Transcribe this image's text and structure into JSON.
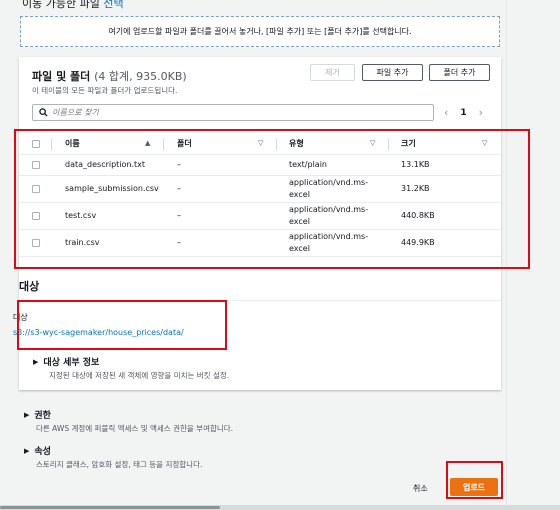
{
  "top_partial": {
    "prefix": "이동 가능한 파일 ",
    "link": "선택"
  },
  "dropzone": {
    "text": "여기에 업로드할 파일과 폴더를 끌어서 놓거나, [파일 추가] 또는 [폴더 추가]를 선택합니다."
  },
  "files_panel": {
    "title": "파일 및 폴더",
    "count": "(4 합계, 935.0KB)",
    "description": "이 테이블의 모든 파일과 폴더가 업로드됩니다.",
    "buttons": {
      "remove": "제거",
      "add_files": "파일 추가",
      "add_folder": "폴더 추가"
    },
    "search_placeholder": "이름으로 찾기",
    "page_number": "1",
    "columns": {
      "name": "이름",
      "folder": "폴더",
      "type": "유형",
      "size": "크기"
    },
    "rows": [
      {
        "name": "data_description.txt",
        "folder": "–",
        "type_line1": "text/plain",
        "type_line2": "",
        "size": "13.1KB"
      },
      {
        "name": "sample_submission.csv",
        "folder": "–",
        "type_line1": "application/vnd.ms-",
        "type_line2": "excel",
        "size": "31.2KB"
      },
      {
        "name": "test.csv",
        "folder": "–",
        "type_line1": "application/vnd.ms-",
        "type_line2": "excel",
        "size": "440.8KB"
      },
      {
        "name": "train.csv",
        "folder": "–",
        "type_line1": "application/vnd.ms-",
        "type_line2": "excel",
        "size": "449.9KB"
      }
    ]
  },
  "destination": {
    "title": "대상",
    "label": "대상",
    "path": "s3://s3-wyc-sagemaker/house_prices/data/",
    "details_title": "대상 세부 정보",
    "details_desc": "지정된 대상에 저장된 새 객체에 영향을 미치는 버킷 설정."
  },
  "permissions": {
    "title": "권한",
    "desc": "다른 AWS 계정에 퍼블릭 액세스 및 액세스 권한을 부여합니다."
  },
  "properties": {
    "title": "속성",
    "desc": "스토리지 클래스, 암호화 설정, 태그 등을 지정합니다."
  },
  "footer": {
    "cancel": "취소",
    "upload": "업로드"
  },
  "colors": {
    "accent": "#ec7211",
    "link": "#0073bb",
    "highlight": "#e30613"
  }
}
